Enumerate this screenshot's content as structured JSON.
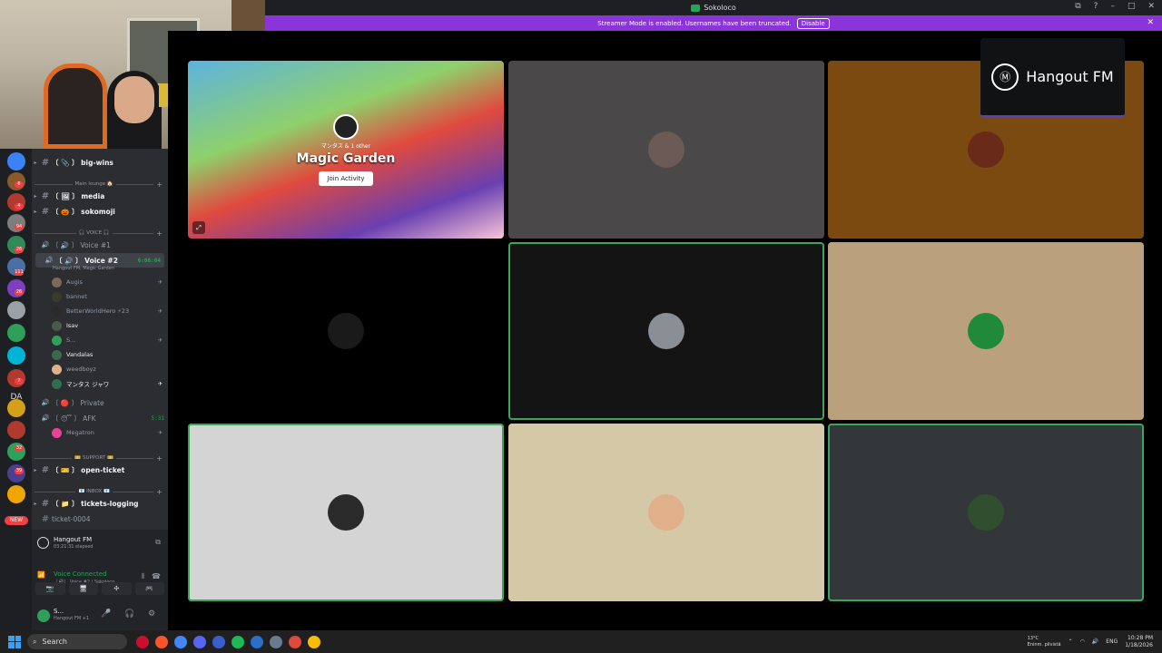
{
  "window": {
    "title": "Sokoloco",
    "controls": [
      "⧉",
      "?",
      "–",
      "□",
      "✕"
    ]
  },
  "banner": {
    "text": "Streamer Mode is enabled. Usernames have been truncated.",
    "button": "Disable",
    "close": "✕"
  },
  "guilds": {
    "da_label": "DA",
    "new_badge": "NEW",
    "badges": [
      "6",
      "4",
      "94",
      "26",
      "111",
      "26",
      "7",
      "32",
      "39"
    ]
  },
  "channels": {
    "rows": [
      {
        "type": "text",
        "label": "〔 📎 〕 big-wins",
        "bright": true
      },
      {
        "type": "cat",
        "label": "Main lounge 🏠"
      },
      {
        "type": "text",
        "label": "〔 🖼 〕 media",
        "bright": true
      },
      {
        "type": "text",
        "label": "〔 🎃 〕 sokomoji",
        "bright": true
      },
      {
        "type": "cat",
        "label": "🎧 VOICE 🎧"
      },
      {
        "type": "voice",
        "label": "〔 🔊 〕 Voice #1"
      },
      {
        "type": "voice",
        "label": "〔 🔊 〕 Voice #2",
        "bright": true,
        "active": true,
        "timer": "6:06:04",
        "sub": "Hangout FM, Magic Garden"
      },
      {
        "type": "voice",
        "label": "〔 🔴 〕 Private"
      },
      {
        "type": "voice",
        "label": "〔 😴 〕 AFK",
        "timer": "5:31"
      },
      {
        "type": "cat",
        "label": "🎫 SUPPORT 🎫"
      },
      {
        "type": "text",
        "label": "〔 🎫 〕 open-ticket",
        "bright": true
      },
      {
        "type": "cat",
        "label": "📧 INBOX 📧"
      },
      {
        "type": "text",
        "label": "〔 📁 〕 tickets-logging",
        "bright": true
      },
      {
        "type": "text",
        "label": "ticket-0004"
      }
    ],
    "voice_users": [
      {
        "name": "Augis",
        "icon": "✈",
        "bright": false
      },
      {
        "name": "bannet",
        "icon": "",
        "bright": false
      },
      {
        "name": "BetterWorldHero ⚡23",
        "icon": "✈",
        "bright": false
      },
      {
        "name": "Isav",
        "icon": "",
        "bright": true
      },
      {
        "name": "S...",
        "icon": "✈",
        "bright": false
      },
      {
        "name": "Vandalas",
        "icon": "",
        "bright": true
      },
      {
        "name": "weedboyz",
        "icon": "",
        "bright": false
      },
      {
        "name": "マンタス ジャワ",
        "icon": "✈",
        "bright": true
      }
    ],
    "afk_users": [
      {
        "name": "Megatron",
        "icon": "✈"
      }
    ]
  },
  "hangout_panel": {
    "title": "Hangout FM",
    "elapsed": "03:21:31 elapsed"
  },
  "voice_panel": {
    "status": "Voice Connected",
    "channel": "〔🔊〕 Voice #2 / Sokoloco",
    "buttons": [
      "📷",
      "🖥",
      "✣",
      "🎮"
    ]
  },
  "user_panel": {
    "name": "S...",
    "status": "Hangout FM +1"
  },
  "stage": {
    "activity": {
      "caption": "マンタス & 1 other",
      "title": "Magic Garden",
      "button": "Join Activity",
      "popout": "⤢"
    },
    "card": {
      "text": "Hangout FM",
      "icon": "Ⓜ"
    },
    "tiles": [
      {
        "bg": "#4a4848",
        "avatar": "#6b5a55",
        "speaking": false
      },
      {
        "bg": "#7a4a11",
        "avatar": "#6a2a1a",
        "speaking": false
      },
      {
        "bg": "#000000",
        "avatar": "#1a1a1a",
        "speaking": false
      },
      {
        "bg": "#141414",
        "avatar": "#8a8f96",
        "speaking": true
      },
      {
        "bg": "#bba07e",
        "avatar": "#1f8a3a",
        "speaking": false
      },
      {
        "bg": "#d4d4d4",
        "avatar": "#2a2a2a",
        "speaking": true
      },
      {
        "bg": "#d5c8a7",
        "avatar": "#e0b08a",
        "speaking": false
      },
      {
        "bg": "#34373a",
        "avatar": "#2f4f2f",
        "speaking": true
      }
    ]
  },
  "taskbar": {
    "search": "Search",
    "weather_temp": "13°C",
    "weather_text": "Eninm. pilvistä",
    "lang": "ENG",
    "time": "10:28 PM",
    "date": "1/18/2026"
  },
  "colors": {
    "accent": "#5865f2",
    "speaking": "#3ba55d",
    "banner": "#8b34d9"
  }
}
